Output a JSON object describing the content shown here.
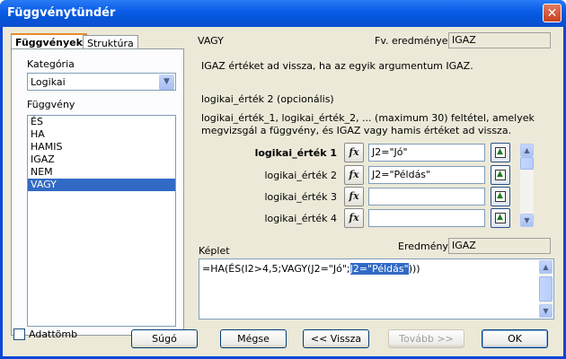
{
  "window": {
    "title": "Függvénytündér"
  },
  "tabs": [
    {
      "label": "Függvények"
    },
    {
      "label": "Struktúra"
    }
  ],
  "category": {
    "label": "Kategória",
    "selected": "Logikai"
  },
  "function_list": {
    "label": "Függvény",
    "items": [
      "ÉS",
      "HA",
      "HAMIS",
      "IGAZ",
      "NEM",
      "VAGY"
    ],
    "selected": "VAGY"
  },
  "function_info": {
    "name": "VAGY",
    "result_label": "Fv. eredménye:",
    "result_value": "IGAZ",
    "description": "IGAZ értéket ad vissza, ha az egyik argumentum IGAZ.",
    "arg_title": "logikai_érték 2 (opcionális)",
    "arg_description": "logikai_érték_1, logikai_érték_2, ... (maximum 30) feltétel, amelyek megvizsgál a függvény, és IGAZ vagy hamis értéket ad vissza."
  },
  "arguments": [
    {
      "label": "logikai_érték 1",
      "value": "J2=\"Jó\""
    },
    {
      "label": "logikai_érték 2",
      "value": "J2=\"Példás\""
    },
    {
      "label": "logikai_érték 3",
      "value": ""
    },
    {
      "label": "logikai_érték 4",
      "value": ""
    }
  ],
  "formula": {
    "label": "Képlet",
    "text_before": "=HA(ÉS(I2>4,5;VAGY(J2=\"Jó\";",
    "text_selected": "J2=\"Példás\"",
    "text_after": ")))"
  },
  "result": {
    "label": "Eredmény",
    "value": "IGAZ"
  },
  "array_checkbox": {
    "label": "Adattömb",
    "checked": false
  },
  "buttons": {
    "help": "Súgó",
    "cancel": "Mégse",
    "back": "<< Vissza",
    "next": "Tovább >>",
    "ok": "OK"
  }
}
